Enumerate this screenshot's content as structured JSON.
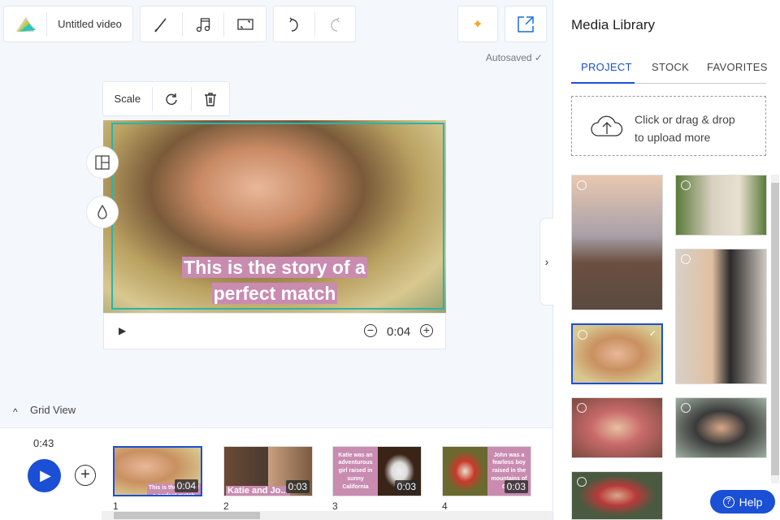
{
  "toolbar": {
    "title": "Untitled video",
    "autosaved": "Autosaved ✓"
  },
  "element_toolbar": {
    "scale": "Scale"
  },
  "preview": {
    "caption_line1": "This is the story of a",
    "caption_line2": "perfect match",
    "time": "0:04"
  },
  "grid": {
    "label": "Grid View",
    "total_time": "0:43",
    "slides": [
      {
        "num": "1",
        "duration": "0:04",
        "text": "This is the story of a perfect match"
      },
      {
        "num": "2",
        "duration": "0:03",
        "text": "Katie and Jo..."
      },
      {
        "num": "3",
        "duration": "0:03",
        "text": "Katie was an adventurous girl raised in sunny California"
      },
      {
        "num": "4",
        "duration": "0:03",
        "text": "John was a fearless boy raised in the mountains of Col..."
      }
    ]
  },
  "library": {
    "title": "Media Library",
    "tabs": [
      "PROJECT",
      "STOCK",
      "FAVORITES"
    ],
    "active_tab": "PROJECT",
    "upload_line1": "Click or drag & drop",
    "upload_line2": "to upload more",
    "help": "Help"
  },
  "colors": {
    "accent": "#1a4fd6",
    "selection": "#25b5b0",
    "caption_bg": "#c98bb0"
  }
}
